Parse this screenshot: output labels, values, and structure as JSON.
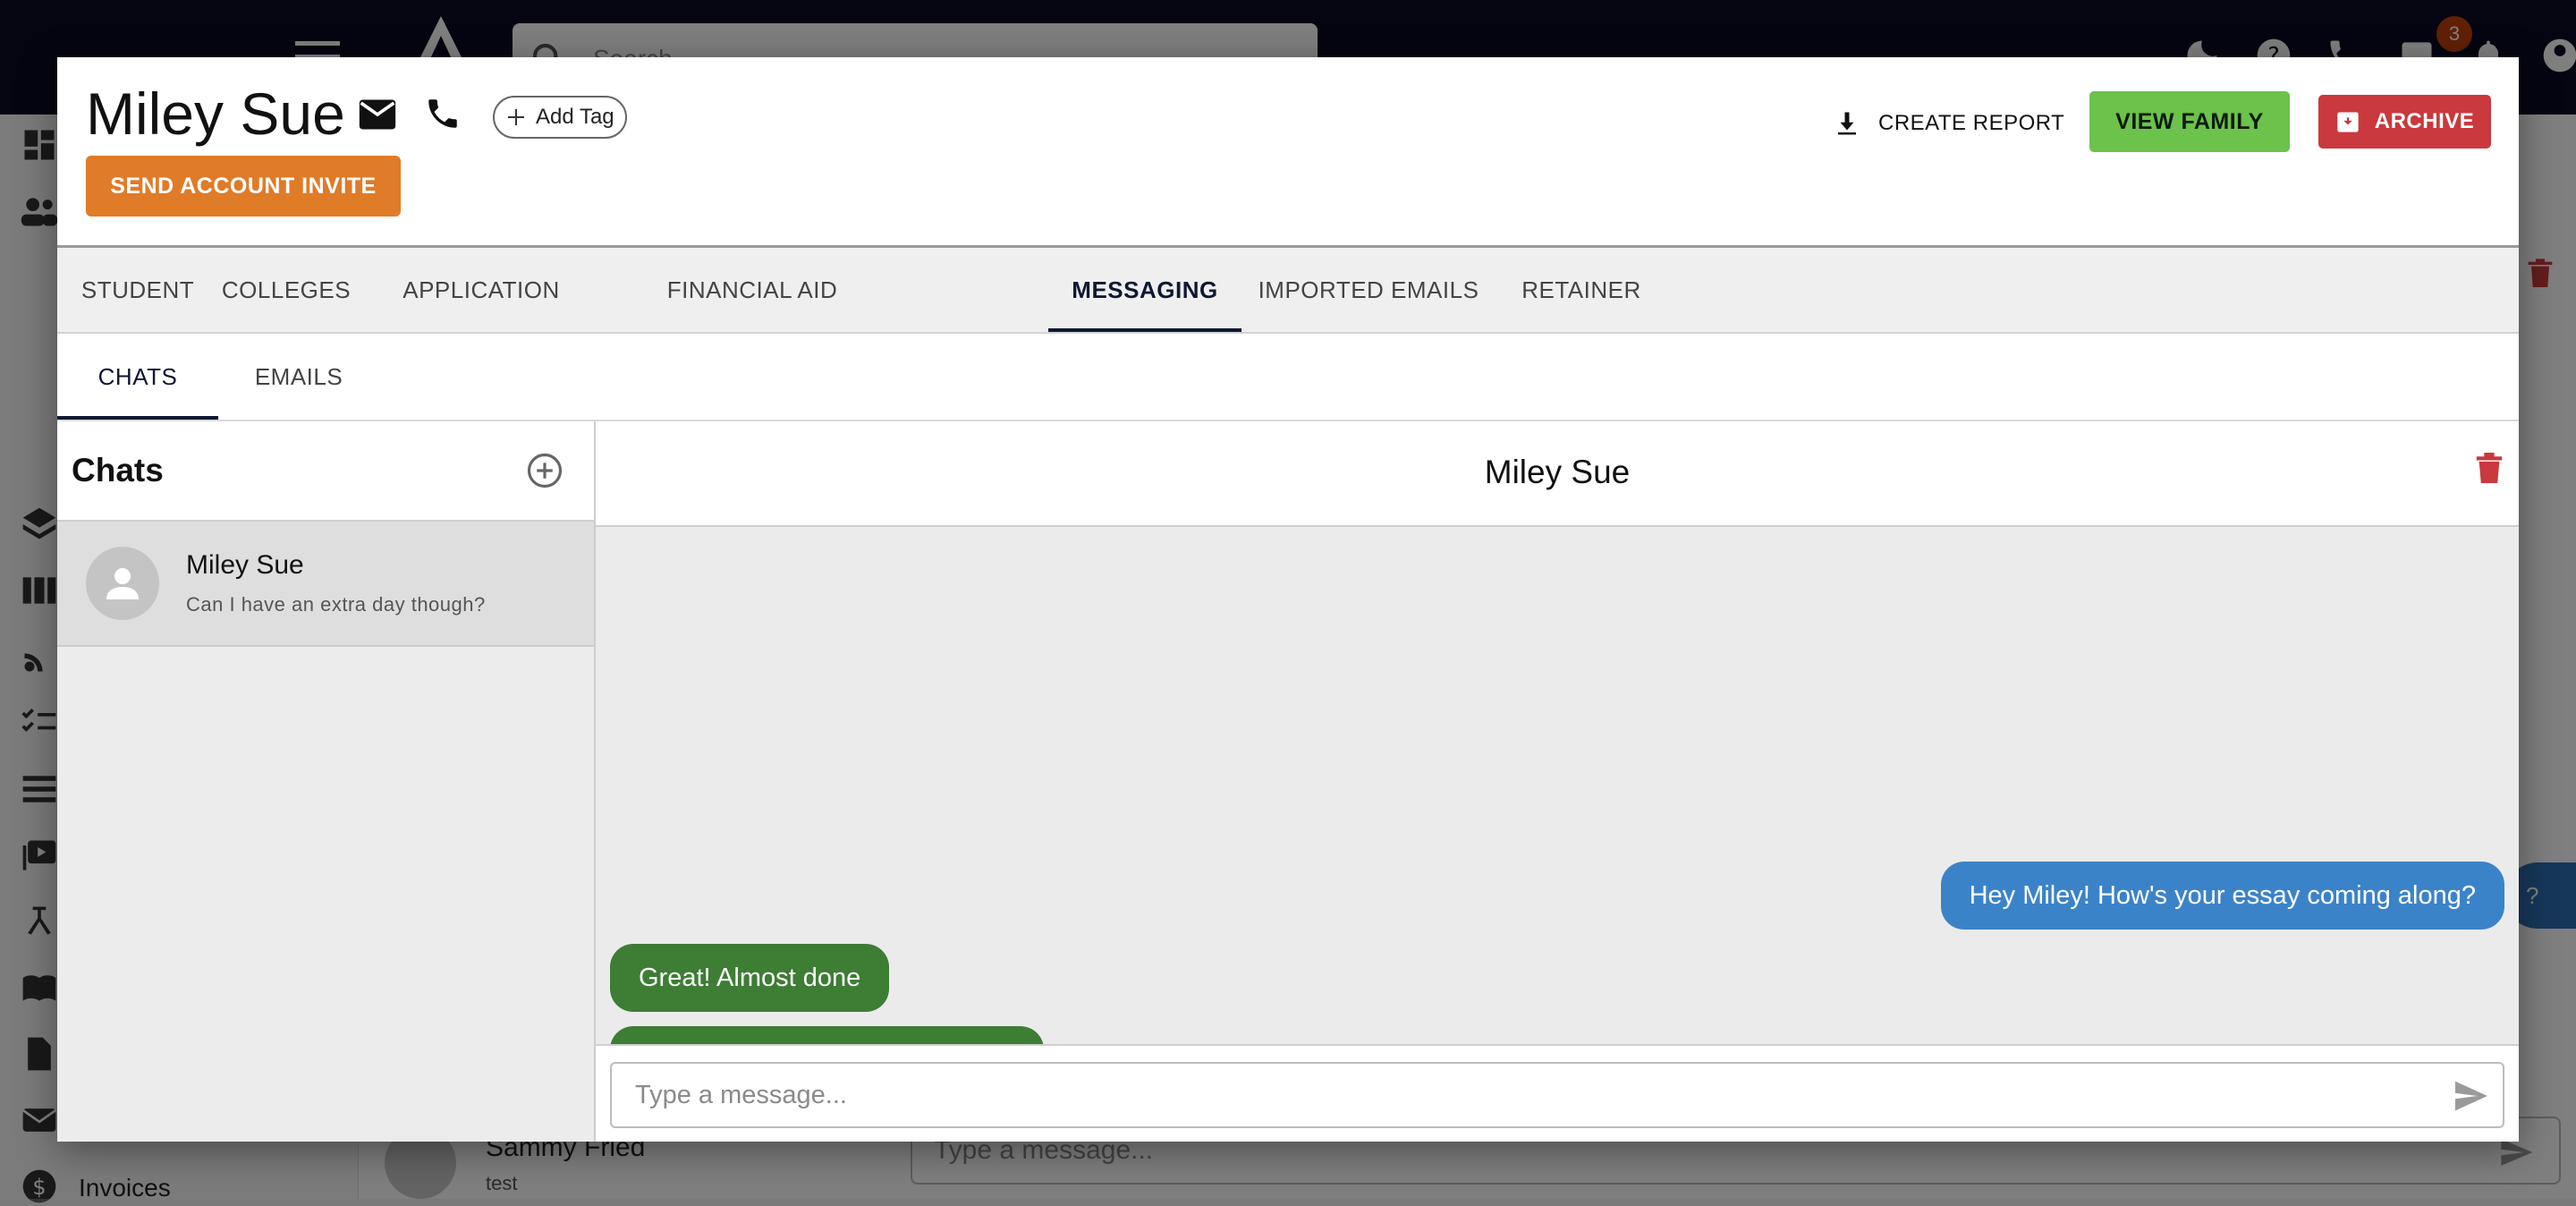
{
  "background": {
    "search_placeholder": "Search",
    "notification_count": "3",
    "invoices_label": "Invoices",
    "bg_chat_name": "Sammy Fried",
    "bg_chat_preview": "test",
    "bg_message_placeholder": "Type a message...",
    "bg_bubble_text": "?"
  },
  "header": {
    "student_name": "Miley Sue",
    "add_tag_label": "Add Tag",
    "send_invite_label": "SEND ACCOUNT INVITE",
    "create_report_label": "CREATE REPORT",
    "view_family_label": "VIEW FAMILY",
    "archive_label": "ARCHIVE"
  },
  "main_tabs": [
    {
      "label": "STUDENT",
      "active": false
    },
    {
      "label": "COLLEGES",
      "active": false
    },
    {
      "label": "APPLICATION TRACKER",
      "active": false
    },
    {
      "label": "FINANCIAL AID TRACKER",
      "active": false
    },
    {
      "label": "MESSAGING",
      "active": true
    },
    {
      "label": "IMPORTED EMAILS",
      "active": false
    },
    {
      "label": "RETAINER",
      "active": false
    }
  ],
  "sub_tabs": [
    {
      "label": "CHATS",
      "active": true
    },
    {
      "label": "EMAILS",
      "active": false
    }
  ],
  "chat_list": {
    "title": "Chats",
    "items": [
      {
        "name": "Miley Sue",
        "preview": "Can I have an extra day though?",
        "selected": true
      }
    ]
  },
  "conversation": {
    "title": "Miley Sue",
    "messages": [
      {
        "direction": "out",
        "text": "Hey Miley! How's your essay coming along?"
      },
      {
        "direction": "in",
        "text": "Great! Almost done"
      },
      {
        "direction": "in",
        "text": "Can I have an extra day though?"
      }
    ],
    "input_placeholder": "Type a message..."
  },
  "colors": {
    "topbar": "#0a0b23",
    "invite_orange": "#e07b27",
    "view_family_green": "#6cc24a",
    "archive_red": "#c9393d",
    "outgoing_blue": "#3b83c9",
    "incoming_green": "#3d7d34"
  }
}
